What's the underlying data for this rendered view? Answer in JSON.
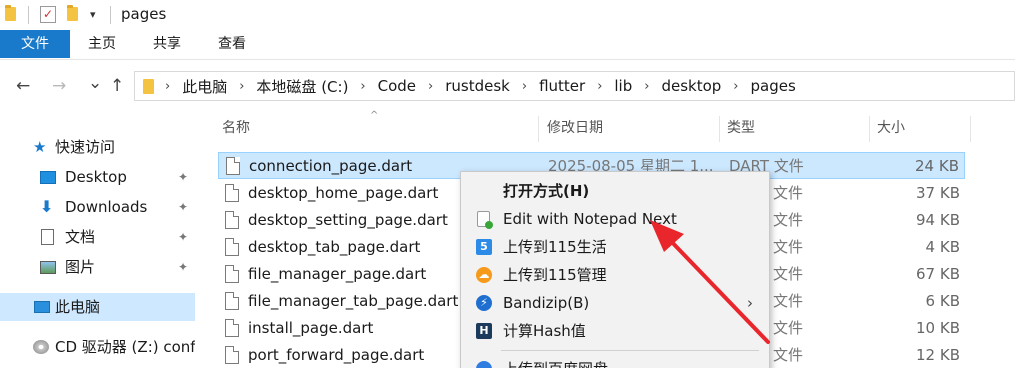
{
  "window": {
    "title": "pages",
    "dropdown_glyph": "▾"
  },
  "ribbon": {
    "tabs": [
      "文件",
      "主页",
      "共享",
      "查看"
    ]
  },
  "nav": {
    "back": "←",
    "forward": "→",
    "recent": "⌄",
    "up": "↑",
    "breadcrumbs": [
      "此电脑",
      "本地磁盘 (C:)",
      "Code",
      "rustdesk",
      "flutter",
      "lib",
      "desktop",
      "pages"
    ],
    "crumb_separator": "›"
  },
  "columns": {
    "name": "名称",
    "modified": "修改日期",
    "type": "类型",
    "size": "大小",
    "sort_indicator": "^"
  },
  "sidebar": {
    "items": [
      {
        "label": "快速访问",
        "icon": "star-icon"
      },
      {
        "label": "Desktop",
        "icon": "desktop-folder-icon",
        "pinned": true
      },
      {
        "label": "Downloads",
        "icon": "downloads-icon",
        "pinned": true
      },
      {
        "label": "文档",
        "icon": "documents-icon",
        "pinned": true
      },
      {
        "label": "图片",
        "icon": "pictures-icon",
        "pinned": true
      },
      {
        "label": "此电脑",
        "icon": "this-pc-icon",
        "selected": true
      },
      {
        "label": "CD 驱动器 (Z:) config",
        "icon": "cd-drive-icon"
      }
    ],
    "pin_glyph": "📌"
  },
  "files": [
    {
      "name": "connection_page.dart",
      "date": "2025-08-05 星期二 1...",
      "type": "DART 文件",
      "size": "24 KB",
      "selected": true
    },
    {
      "name": "desktop_home_page.dart",
      "date": "",
      "type": "文件",
      "size": "37 KB"
    },
    {
      "name": "desktop_setting_page.dart",
      "date": "",
      "type": "文件",
      "size": "94 KB"
    },
    {
      "name": "desktop_tab_page.dart",
      "date": "",
      "type": "文件",
      "size": "4 KB"
    },
    {
      "name": "file_manager_page.dart",
      "date": "",
      "type": "文件",
      "size": "67 KB"
    },
    {
      "name": "file_manager_tab_page.dart",
      "date": "",
      "type": "文件",
      "size": "6 KB"
    },
    {
      "name": "install_page.dart",
      "date": "",
      "type": "文件",
      "size": "10 KB"
    },
    {
      "name": "port_forward_page.dart",
      "date": "",
      "type": "文件",
      "size": "12 KB"
    }
  ],
  "context_menu": {
    "items": [
      {
        "label": "打开方式(H)",
        "icon": "",
        "bold": true
      },
      {
        "label": "Edit with Notepad Next",
        "icon": "notepad-next-icon"
      },
      {
        "label": "上传到115生活",
        "icon": "115-life-icon"
      },
      {
        "label": "上传到115管理",
        "icon": "115-manage-icon"
      },
      {
        "label": "Bandizip(B)",
        "icon": "bandizip-icon",
        "submenu": true
      },
      {
        "label": "计算Hash值",
        "icon": "hash-icon"
      },
      {
        "label": "上传到百度网盘",
        "icon": "baidu-netdisk-icon"
      }
    ],
    "submenu_glyph": "›"
  },
  "colors": {
    "accent": "#1979ca",
    "selection": "#cce8ff",
    "annotation_arrow": "#e8262b"
  }
}
